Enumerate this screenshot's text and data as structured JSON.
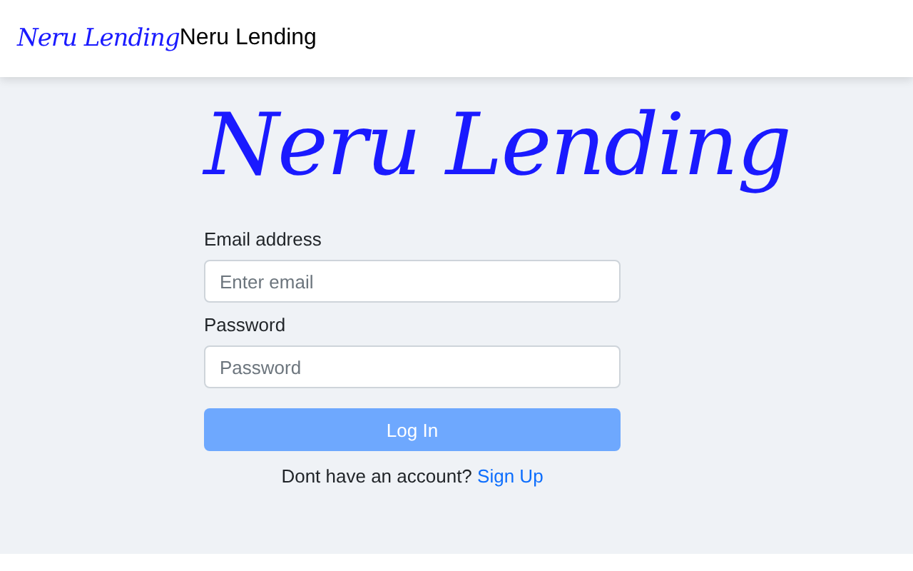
{
  "navbar": {
    "logo": "Neru Lending",
    "brand": "Neru Lending"
  },
  "title": "Neru Lending",
  "form": {
    "fields": [
      {
        "label": "Email address",
        "placeholder": "Enter email"
      },
      {
        "label": "Password",
        "placeholder": "Password"
      }
    ],
    "submit": {
      "label": "Log In",
      "disabled": true
    },
    "footer": {
      "text": "Dont have an account?",
      "link": "Sign Up"
    }
  }
}
